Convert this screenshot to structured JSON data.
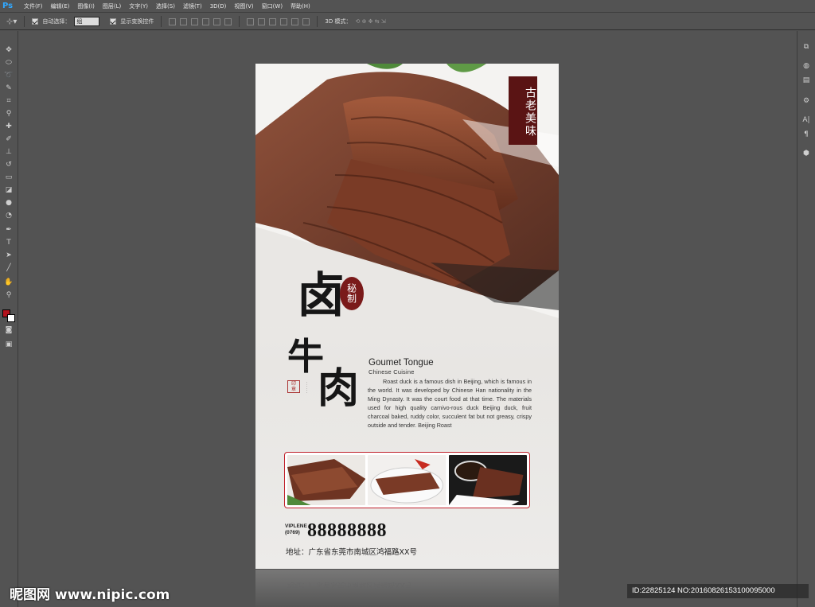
{
  "app": {
    "logo": "Ps"
  },
  "menu": [
    "文件(F)",
    "编辑(E)",
    "图像(I)",
    "图层(L)",
    "文字(Y)",
    "选择(S)",
    "滤镜(T)",
    "3D(D)",
    "视图(V)",
    "窗口(W)",
    "帮助(H)"
  ],
  "options": {
    "auto_select_label": "自动选择：",
    "auto_select_value": "组",
    "show_transform_label": "显示变换控件",
    "mode_3d_label": "3D 模式："
  },
  "poster": {
    "seal_text": "古老美味",
    "red_seal_text": "秘制",
    "title_lu": "卤",
    "title_niu": "牛",
    "title_rou": "肉",
    "en_title": "Goumet Tongue",
    "en_subtitle": "Chinese  Cuisine",
    "description": "Roast duck is a famous dish in Beijing, which is famous in the world. It was developed by Chinese Han nationality in the Ming Dynasty. It was the court food at that time. The materials used for high quality carnivo-rous duck Beijing duck, fruit charcoal baked, ruddy color, succulent fat but not greasy, crispy outside and tender. Beijing Roast",
    "viplene": "VIPLENE",
    "phone_code": "(0769)",
    "phone": "88888888",
    "address": "地址：广东省东莞市南城区鸿福路XX号"
  },
  "watermark": {
    "left": "昵图网 www.nipic.com",
    "right": "ID:22825124 NO:20160826153100095000"
  },
  "colors": {
    "seal_bg": "#5a1414",
    "frame_red": "#c0202a",
    "ps_blue": "#31a8ff"
  }
}
